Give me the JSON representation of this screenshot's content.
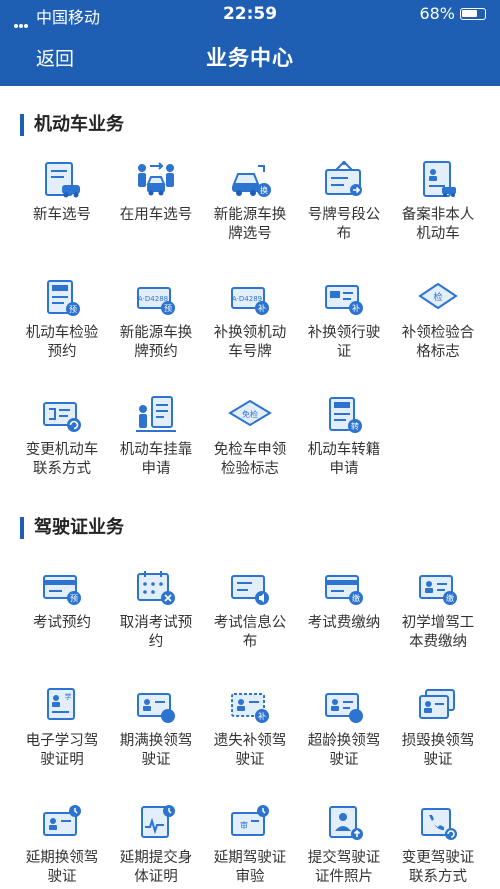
{
  "status_bar": {
    "carrier": "中国移动",
    "time": "22:59",
    "battery": "68%"
  },
  "header": {
    "back_label": "返回",
    "title": "业务中心"
  },
  "colors": {
    "primary": "#1f5fb3",
    "icon_blue": "#2c74d0",
    "light_blue": "#e3eefb"
  },
  "sections": [
    {
      "title": "机动车业务",
      "items": [
        {
          "label": "新车选号",
          "icon": "car-document-icon"
        },
        {
          "label": "在用车选号",
          "icon": "people-car-icon"
        },
        {
          "label": "新能源车换牌选号",
          "icon": "electric-car-icon"
        },
        {
          "label": "号牌号段公布",
          "icon": "sign-board-icon"
        },
        {
          "label": "备案非本人机动车",
          "icon": "registration-form-icon"
        },
        {
          "label": "机动车检验预约",
          "icon": "inspection-booking-icon"
        },
        {
          "label": "新能源车换牌预约",
          "icon": "plate-booking-icon"
        },
        {
          "label": "补换领机动车号牌",
          "icon": "plate-replace-icon"
        },
        {
          "label": "补换领行驶证",
          "icon": "license-replace-icon"
        },
        {
          "label": "补领检验合格标志",
          "icon": "inspection-badge-icon"
        },
        {
          "label": "变更机动车联系方式",
          "icon": "contact-change-icon"
        },
        {
          "label": "机动车挂靠申请",
          "icon": "affiliation-icon"
        },
        {
          "label": "免检车申领检验标志",
          "icon": "exempt-badge-icon"
        },
        {
          "label": "机动车转籍申请",
          "icon": "transfer-doc-icon"
        }
      ]
    },
    {
      "title": "驾驶证业务",
      "items": [
        {
          "label": "考试预约",
          "icon": "exam-booking-icon"
        },
        {
          "label": "取消考试预约",
          "icon": "cancel-calendar-icon"
        },
        {
          "label": "考试信息公布",
          "icon": "exam-notice-icon"
        },
        {
          "label": "考试费缴纳",
          "icon": "fee-payment-icon"
        },
        {
          "label": "初学增驾工本费缴纳",
          "icon": "license-fee-icon"
        },
        {
          "label": "电子学习驾驶证明",
          "icon": "learner-permit-icon"
        },
        {
          "label": "期满换领驾驶证",
          "icon": "expiry-renew-icon"
        },
        {
          "label": "遗失补领驾驶证",
          "icon": "lost-replace-icon"
        },
        {
          "label": "超龄换领驾驶证",
          "icon": "overage-renew-icon"
        },
        {
          "label": "损毁换领驾驶证",
          "icon": "damaged-renew-icon"
        },
        {
          "label": "延期换领驾驶证",
          "icon": "delay-renew-icon"
        },
        {
          "label": "延期提交身体证明",
          "icon": "health-proof-icon"
        },
        {
          "label": "延期驾驶证审验",
          "icon": "delay-review-icon"
        },
        {
          "label": "提交驾驶证证件照片",
          "icon": "photo-upload-icon"
        },
        {
          "label": "变更驾驶证联系方式",
          "icon": "phone-change-icon"
        }
      ]
    }
  ]
}
